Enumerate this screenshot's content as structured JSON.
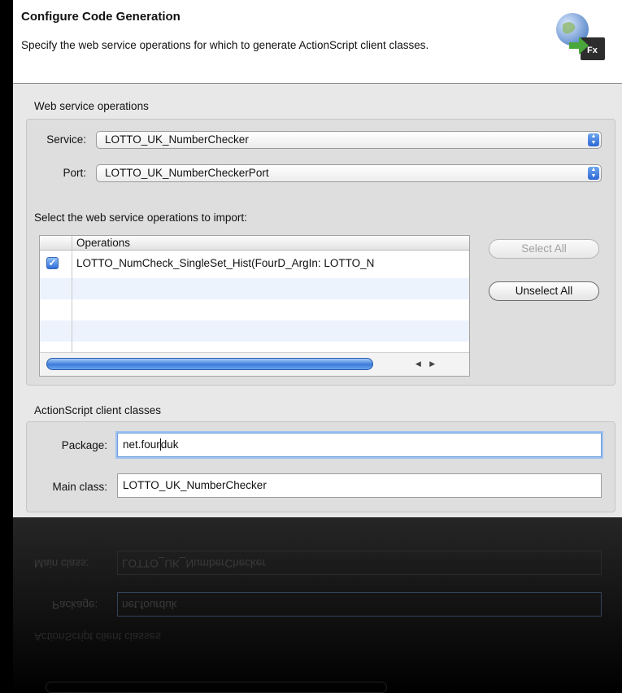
{
  "header": {
    "title": "Configure Code Generation",
    "description": "Specify the web service operations for which to generate ActionScript client classes.",
    "icon_badge": "Fx"
  },
  "operations_section": {
    "label": "Web service operations",
    "service_label": "Service:",
    "service_value": "LOTTO_UK_NumberChecker",
    "port_label": "Port:",
    "port_value": "LOTTO_UK_NumberCheckerPort",
    "select_prompt": "Select the web service operations to import:",
    "table": {
      "column_header": "Operations",
      "rows": [
        {
          "checked": true,
          "operation": "LOTTO_NumCheck_SingleSet_Hist(FourD_ArgIn: LOTTO_N"
        }
      ]
    },
    "select_all_label": "Select All",
    "unselect_all_label": "Unselect All"
  },
  "client_section": {
    "label": "ActionScript client classes",
    "package_label": "Package:",
    "package_value_before_caret": "net.four",
    "package_value_after_caret": "duk",
    "main_class_label": "Main class:",
    "main_class_value": "LOTTO_UK_NumberChecker"
  },
  "reflection": {
    "main_class_label": "Main class:",
    "main_class_value": "LOTTO_UK_NumberChecker",
    "package_label": "Package:",
    "package_value": "net.fourduk",
    "section_label": "ActionScript client classes"
  },
  "colors": {
    "accent_blue": "#2c67d6",
    "dialog_bg": "#e8e8e8",
    "header_bg": "#ffffff",
    "outer_bg": "#000000"
  }
}
